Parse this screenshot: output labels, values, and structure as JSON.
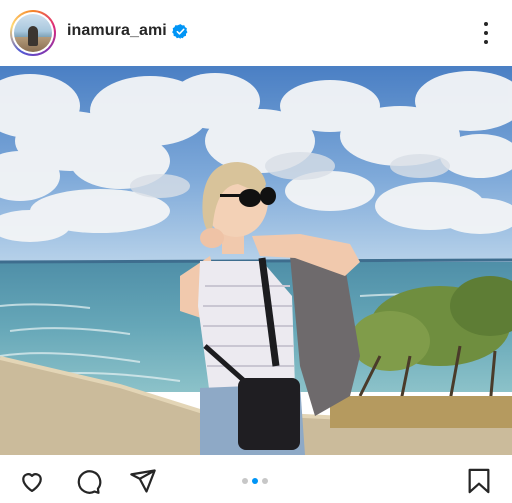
{
  "post": {
    "username": "inamura_ami",
    "verified": true,
    "carousel": {
      "total": 3,
      "active_index": 1
    }
  },
  "icons": {
    "header": [
      "avatar",
      "verified-badge-icon",
      "more-options-icon"
    ],
    "actions": [
      "heart-icon",
      "comment-icon",
      "share-icon",
      "bookmark-icon"
    ]
  },
  "colors": {
    "accent_blue": "#0095f6",
    "text": "#262626",
    "inactive_dot": "#c7c7c7"
  }
}
